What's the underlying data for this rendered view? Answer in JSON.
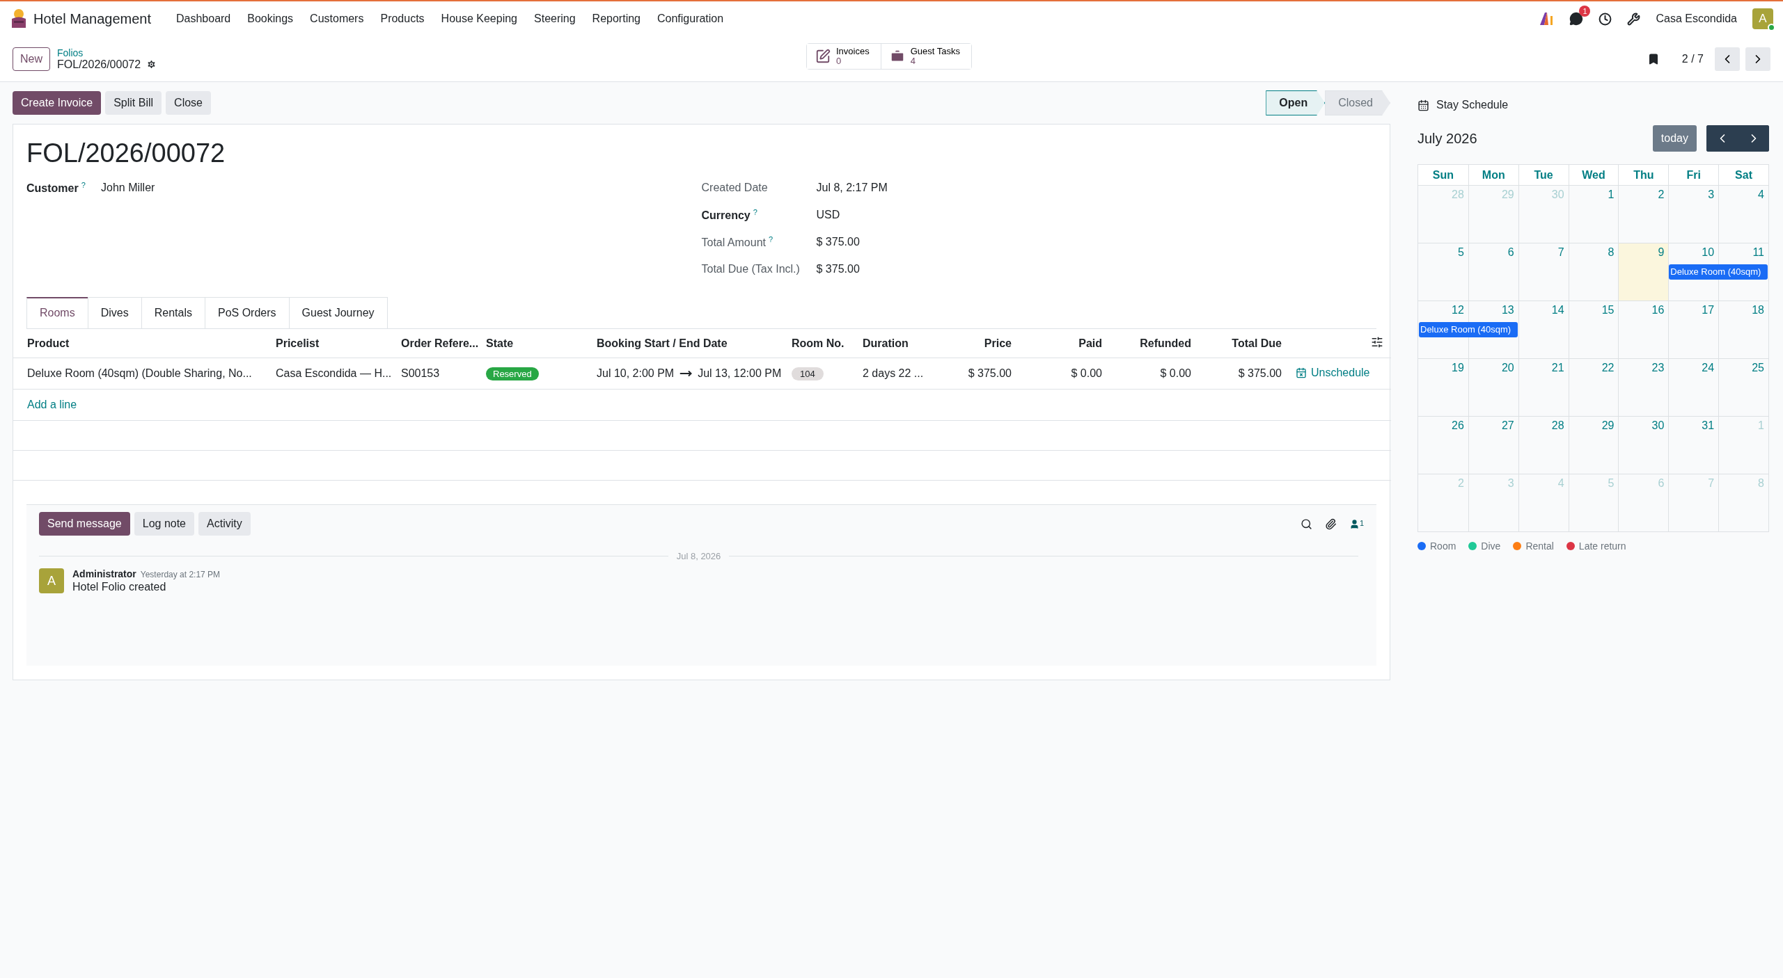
{
  "app": {
    "title": "Hotel Management",
    "menu": [
      "Dashboard",
      "Bookings",
      "Customers",
      "Products",
      "House Keeping",
      "Steering",
      "Reporting",
      "Configuration"
    ],
    "messages_badge": "1",
    "company": "Casa Escondida",
    "avatar": "A"
  },
  "control": {
    "new_button": "New",
    "breadcrumb": "Folios",
    "record": "FOL/2026/00072",
    "smart_buttons": [
      {
        "kind": "invoice",
        "label": "Invoices",
        "value": "0"
      },
      {
        "kind": "tasks",
        "label": "Guest Tasks",
        "value": "4"
      }
    ],
    "pager": "2 / 7"
  },
  "actions": [
    {
      "label": "Create Invoice",
      "kind": "primary"
    },
    {
      "label": "Split Bill",
      "kind": "secondary"
    },
    {
      "label": "Close",
      "kind": "secondary"
    }
  ],
  "statusbar": [
    {
      "label": "Open",
      "selected": true
    },
    {
      "label": "Closed",
      "selected": false
    }
  ],
  "form": {
    "title": "FOL/2026/00072",
    "left_fields": [
      {
        "label": "Customer",
        "help": "?",
        "value": "John Miller",
        "strong": true
      }
    ],
    "right_fields": [
      {
        "label": "Created Date",
        "value": "Jul 8, 2:17 PM",
        "strong": false
      },
      {
        "label": "Currency",
        "help": "?",
        "value": "USD",
        "strong": true
      },
      {
        "label": "Total Amount",
        "help": "?",
        "value": "$ 375.00",
        "strong": false
      },
      {
        "label": "Total Due (Tax Incl.)",
        "value": "$ 375.00",
        "strong": false
      }
    ]
  },
  "tabs": [
    {
      "label": "Rooms",
      "selected": true
    },
    {
      "label": "Dives",
      "selected": false
    },
    {
      "label": "Rentals",
      "selected": false
    },
    {
      "label": "PoS Orders",
      "selected": false
    },
    {
      "label": "Guest Journey",
      "selected": false
    }
  ],
  "table": {
    "columns": [
      "Product",
      "Pricelist",
      "Order Refere...",
      "State",
      "Booking Start / End Date",
      "Room No.",
      "Duration",
      "Price",
      "Paid",
      "Refunded",
      "Total Due"
    ],
    "rows": [
      {
        "product": "Deluxe Room (40sqm) (Double Sharing, No...",
        "pricelist": "Casa Escondida — H...",
        "order": "S00153",
        "state": "Reserved",
        "start": "Jul 10, 2:00 PM",
        "end": "Jul 13, 12:00 PM",
        "room": "104",
        "duration": "2 days 22 ...",
        "price": "$ 375.00",
        "paid": "$ 0.00",
        "refunded": "$ 0.00",
        "total": "$ 375.00",
        "action": "Unschedule"
      }
    ],
    "add_line": "Add a line"
  },
  "chatter": {
    "buttons": [
      {
        "label": "Send message",
        "kind": "primary"
      },
      {
        "label": "Log note",
        "kind": "secondary"
      },
      {
        "label": "Activity",
        "kind": "secondary"
      }
    ],
    "followers": "1",
    "date_separator": "Jul 8, 2026",
    "messages": [
      {
        "avatar": "A",
        "author": "Administrator",
        "time": "Yesterday at 2:17 PM",
        "body": "Hotel Folio created"
      }
    ]
  },
  "schedule": {
    "title": "Stay Schedule",
    "month": "July 2026",
    "today_button": "today",
    "weekdays": [
      "Sun",
      "Mon",
      "Tue",
      "Wed",
      "Thu",
      "Fri",
      "Sat"
    ],
    "weeks": [
      [
        {
          "d": "28",
          "muted": true
        },
        {
          "d": "29",
          "muted": true
        },
        {
          "d": "30",
          "muted": true
        },
        {
          "d": "1",
          "muted": false
        },
        {
          "d": "2",
          "muted": false
        },
        {
          "d": "3",
          "muted": false
        },
        {
          "d": "4",
          "muted": false
        }
      ],
      [
        {
          "d": "5",
          "muted": false
        },
        {
          "d": "6",
          "muted": false
        },
        {
          "d": "7",
          "muted": false
        },
        {
          "d": "8",
          "muted": false
        },
        {
          "d": "9",
          "muted": false,
          "today": true
        },
        {
          "d": "10",
          "muted": false,
          "event": {
            "label": "Deluxe Room (40sqm)",
            "color": "#1a6cf5"
          }
        },
        {
          "d": "11",
          "muted": false,
          "booked": true
        }
      ],
      [
        {
          "d": "12",
          "muted": false,
          "event": {
            "label": "Deluxe Room (40sqm)",
            "color": "#1a6cf5"
          }
        },
        {
          "d": "13",
          "muted": false,
          "booked": true
        },
        {
          "d": "14",
          "muted": false
        },
        {
          "d": "15",
          "muted": false
        },
        {
          "d": "16",
          "muted": false
        },
        {
          "d": "17",
          "muted": false
        },
        {
          "d": "18",
          "muted": false
        }
      ],
      [
        {
          "d": "19",
          "muted": false
        },
        {
          "d": "20",
          "muted": false
        },
        {
          "d": "21",
          "muted": false
        },
        {
          "d": "22",
          "muted": false
        },
        {
          "d": "23",
          "muted": false
        },
        {
          "d": "24",
          "muted": false
        },
        {
          "d": "25",
          "muted": false
        }
      ],
      [
        {
          "d": "26",
          "muted": false
        },
        {
          "d": "27",
          "muted": false
        },
        {
          "d": "28",
          "muted": false
        },
        {
          "d": "29",
          "muted": false
        },
        {
          "d": "30",
          "muted": false
        },
        {
          "d": "31",
          "muted": false
        },
        {
          "d": "1",
          "muted": true
        }
      ],
      [
        {
          "d": "2",
          "muted": true
        },
        {
          "d": "3",
          "muted": true
        },
        {
          "d": "4",
          "muted": true
        },
        {
          "d": "5",
          "muted": true
        },
        {
          "d": "6",
          "muted": true
        },
        {
          "d": "7",
          "muted": true
        },
        {
          "d": "8",
          "muted": true
        }
      ]
    ],
    "legend": [
      {
        "label": "Room",
        "color": "#1a6cf5"
      },
      {
        "label": "Dive",
        "color": "#20c997"
      },
      {
        "label": "Rental",
        "color": "#fd7e14"
      },
      {
        "label": "Late return",
        "color": "#dc3545"
      }
    ]
  }
}
